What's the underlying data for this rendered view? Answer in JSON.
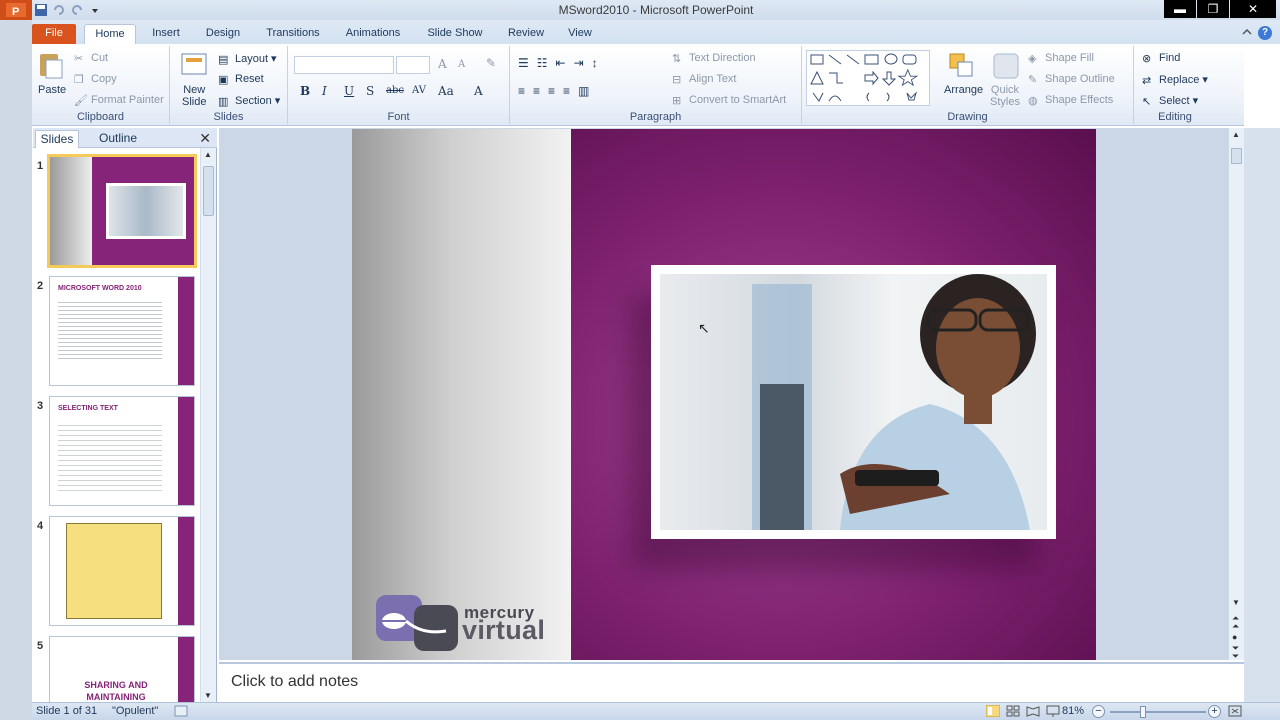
{
  "window": {
    "title": "MSword2010  -  Microsoft PowerPoint",
    "minimize": "▬",
    "maximize": "❐",
    "close": "✕"
  },
  "tabs": [
    "File",
    "Home",
    "Insert",
    "Design",
    "Transitions",
    "Animations",
    "Slide Show",
    "Review",
    "View"
  ],
  "ribbon": {
    "clipboard": {
      "paste": "Paste",
      "cut": "Cut",
      "copy": "Copy",
      "format_painter": "Format Painter",
      "label": "Clipboard"
    },
    "slides": {
      "new_slide": "New\nSlide",
      "new": "New",
      "slide": "Slide",
      "layout": "Layout",
      "reset": "Reset",
      "section": "Section",
      "label": "Slides"
    },
    "font": {
      "label": "Font",
      "bold": "B",
      "italic": "I",
      "underline": "U",
      "shadow": "S",
      "strike": "abc",
      "spacing": "AV",
      "case": "Aa",
      "grow": "A",
      "shrink": "A",
      "color": "A"
    },
    "paragraph": {
      "text_direction": "Text Direction",
      "align_text": "Align Text",
      "convert_smartart": "Convert to SmartArt",
      "label": "Paragraph"
    },
    "drawing": {
      "arrange": "Arrange",
      "quick_styles_1": "Quick",
      "quick_styles_2": "Styles",
      "shape_fill": "Shape Fill",
      "shape_outline": "Shape Outline",
      "shape_effects": "Shape Effects",
      "label": "Drawing"
    },
    "editing": {
      "find": "Find",
      "replace": "Replace",
      "select": "Select",
      "label": "Editing"
    }
  },
  "panel": {
    "tab_slides": "Slides",
    "tab_outline": "Outline",
    "close": "✕",
    "thumbs": [
      {
        "num": "1"
      },
      {
        "num": "2",
        "title": "MICROSOFT WORD 2010"
      },
      {
        "num": "3",
        "title": "SELECTING TEXT"
      },
      {
        "num": "4"
      },
      {
        "num": "5",
        "title": "SHARING AND MAINTAINING DOCUMENTS"
      }
    ]
  },
  "slide": {
    "logo_word1": "mercury",
    "logo_word2": "virtual"
  },
  "notes": {
    "placeholder": "Click to add notes"
  },
  "status": {
    "slide_info": "Slide 1 of 31",
    "theme": "\"Opulent\"",
    "zoom": "81%",
    "zoom_level": 0.81
  },
  "colors": {
    "accent_purple": "#7e216f",
    "file_tab": "#d9531e",
    "ribbon_text": "#1e395b"
  }
}
